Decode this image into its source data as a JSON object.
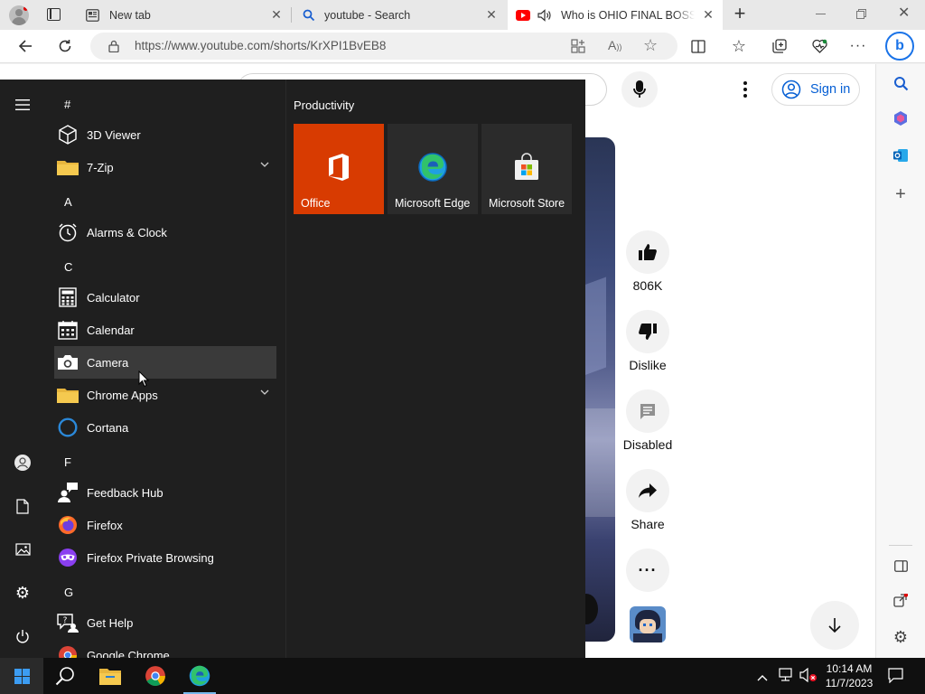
{
  "browser": {
    "tabs": [
      {
        "title": "New tab"
      },
      {
        "title": "youtube - Search"
      },
      {
        "title": "Who is OHIO FINAL BOSS ?"
      }
    ],
    "url": "https://www.youtube.com/shorts/KrXPI1BvEB8"
  },
  "youtube": {
    "signin_label": "Sign in",
    "actions": [
      {
        "label": "806K",
        "icon": "thumbs-up-icon"
      },
      {
        "label": "Dislike",
        "icon": "thumbs-down-icon"
      },
      {
        "label": "Disabled",
        "icon": "comment-icon"
      },
      {
        "label": "Share",
        "icon": "share-icon"
      }
    ]
  },
  "start_menu": {
    "sections": [
      {
        "letter": "#",
        "apps": [
          "3D Viewer",
          "7-Zip"
        ]
      },
      {
        "letter": "A",
        "apps": [
          "Alarms & Clock"
        ]
      },
      {
        "letter": "C",
        "apps": [
          "Calculator",
          "Calendar",
          "Camera",
          "Chrome Apps",
          "Cortana"
        ]
      },
      {
        "letter": "F",
        "apps": [
          "Feedback Hub",
          "Firefox",
          "Firefox Private Browsing"
        ]
      },
      {
        "letter": "G",
        "apps": [
          "Get Help",
          "Google Chrome"
        ]
      }
    ],
    "group_title": "Productivity",
    "tiles": [
      {
        "label": "Office",
        "color": "#d83b01"
      },
      {
        "label": "Microsoft Edge",
        "color": "#2b2b2b"
      },
      {
        "label": "Microsoft Store",
        "color": "#2b2b2b"
      }
    ]
  },
  "taskbar": {
    "time": "10:14 AM",
    "date": "11/7/2023"
  },
  "colors": {
    "accent": "#0078d4",
    "youtube_red": "#ff0000",
    "start_bg": "#1f1f1f",
    "office_tile": "#d83b01"
  }
}
